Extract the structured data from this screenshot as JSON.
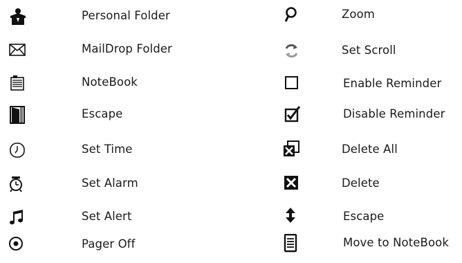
{
  "left_column": [
    {
      "icon": "personal-folder-icon",
      "label": "Personal Folder"
    },
    {
      "icon": "envelope-icon",
      "label": "MailDrop Folder"
    },
    {
      "icon": "notebook-icon",
      "label": "NoteBook"
    },
    {
      "icon": "door-icon",
      "label": "Escape"
    },
    {
      "icon": "clock-icon",
      "label": "Set Time"
    },
    {
      "icon": "alarm-clock-icon",
      "label": "Set Alarm"
    },
    {
      "icon": "music-note-icon",
      "label": "Set Alert"
    },
    {
      "icon": "pager-off-icon",
      "label": "Pager Off"
    }
  ],
  "right_column": [
    {
      "icon": "magnifier-icon",
      "label": "Zoom"
    },
    {
      "icon": "refresh-arrows-icon",
      "label": "Set Scroll"
    },
    {
      "icon": "empty-checkbox-icon",
      "label": "Enable Reminder"
    },
    {
      "icon": "checked-checkbox-icon",
      "label": "Disable Reminder"
    },
    {
      "icon": "delete-all-icon",
      "label": "Delete All"
    },
    {
      "icon": "delete-icon",
      "label": "Delete"
    },
    {
      "icon": "up-down-arrow-icon",
      "label": "Escape"
    },
    {
      "icon": "move-to-notebook-icon",
      "label": "Move to NoteBook"
    }
  ]
}
